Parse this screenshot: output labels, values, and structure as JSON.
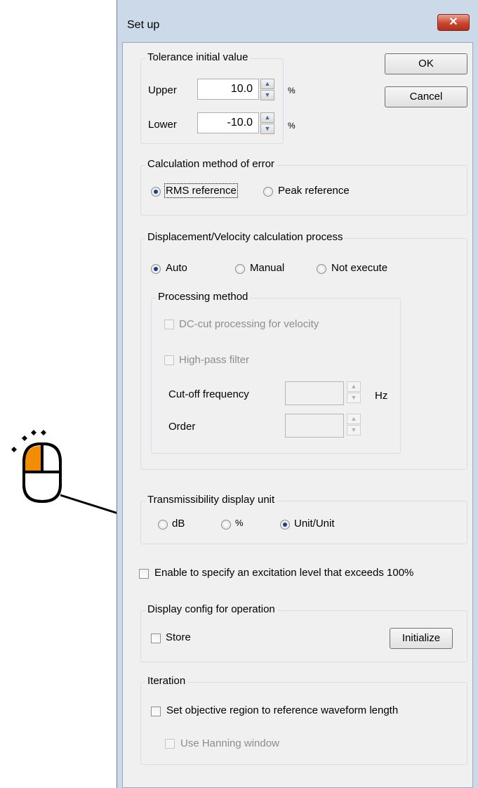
{
  "window": {
    "title": "Set up",
    "close_glyph": "✕"
  },
  "tolerance": {
    "label": "Tolerance initial value",
    "upper_label": "Upper",
    "upper_value": "10.0",
    "lower_label": "Lower",
    "lower_value": "-10.0",
    "unit": "%"
  },
  "buttons": {
    "ok": "OK",
    "cancel": "Cancel",
    "initialize": "Initialize"
  },
  "calc_error": {
    "label": "Calculation method of error",
    "options": [
      "RMS reference",
      "Peak reference"
    ],
    "selected": "RMS reference"
  },
  "displacement": {
    "label": "Displacement/Velocity calculation process",
    "options": [
      "Auto",
      "Manual",
      "Not execute"
    ],
    "selected": "Auto",
    "processing": {
      "label": "Processing method",
      "dc_cut": "DC-cut processing for velocity",
      "high_pass": "High-pass filter",
      "cutoff_label": "Cut-off frequency",
      "cutoff_unit": "Hz",
      "order_label": "Order"
    }
  },
  "transmissibility": {
    "label": "Transmissibility display unit",
    "options": [
      "dB",
      "%",
      "Unit/Unit"
    ],
    "selected": "Unit/Unit"
  },
  "excitation": {
    "label": "Enable to specify an excitation level that exceeds 100%",
    "checked": false
  },
  "display_config": {
    "label": "Display config for operation",
    "store": "Store",
    "checked": false
  },
  "iteration": {
    "label": "Iteration",
    "objective": "Set objective region to reference waveform length",
    "hanning": "Use Hanning window"
  },
  "colors": {
    "mouse_accent": "#f28c00",
    "arrow": "#000000"
  },
  "annotation_icons": {
    "mouse": "mouse-left-click-icon",
    "arrow": "arrow-pointer"
  }
}
